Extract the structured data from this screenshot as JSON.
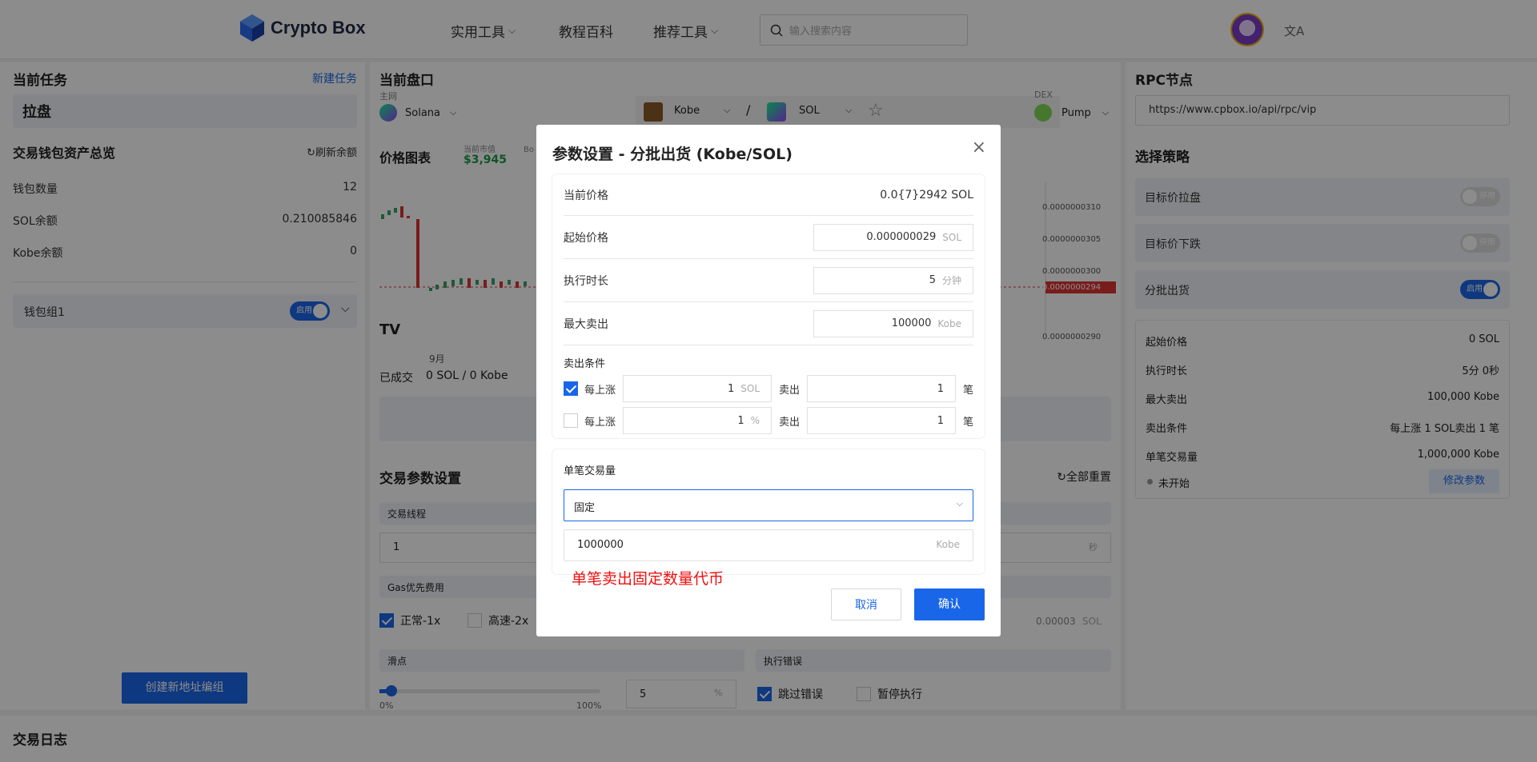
{
  "header": {
    "logo_text": "Crypto Box",
    "nav": [
      {
        "label": "实用工具",
        "dropdown": true
      },
      {
        "label": "教程百科",
        "dropdown": false
      },
      {
        "label": "推荐工具",
        "dropdown": true
      }
    ],
    "search_placeholder": "输入搜索内容",
    "translate_icon": "文A"
  },
  "left_panel": {
    "title": "当前任务",
    "new_task_link": "新建任务",
    "task_name": "拉盘",
    "assets_title": "交易钱包资产总览",
    "refresh_label": "刷新余额",
    "rows": [
      {
        "label": "钱包数量",
        "value": "12"
      },
      {
        "label": "SOL余额",
        "value": "0.210085846"
      },
      {
        "label": "Kobe余额",
        "value": "0"
      }
    ],
    "wallet_group": "钱包组1",
    "wallet_toggle": "启用",
    "create_button": "创建新地址编组"
  },
  "mid_panel": {
    "title": "当前盘口",
    "network_label": "主网",
    "network": "Solana",
    "token_a": "Kobe",
    "separator": "/",
    "token_b": "SOL",
    "dex_label": "DEX",
    "dex": "Pump",
    "chart_title": "价格图表",
    "market_cap_label": "当前市值",
    "market_cap": "$3,945",
    "bo_label": "Bo",
    "price_ticks": [
      "0.0000000310",
      "0.0000000305",
      "0.0000000300",
      "0.0000000294",
      "0.0000000290"
    ],
    "month_label": "9月",
    "tv_logo": "TV",
    "traded_label": "已成交",
    "traded_value": "0 SOL / 0 Kobe",
    "params_title": "交易参数设置",
    "reset_all": "全部重置",
    "threads_label": "交易线程",
    "threads_value": "1",
    "seconds_unit": "秒",
    "gas_label": "Gas优先费用",
    "gas_normal": "正常-1x",
    "gas_fast": "高速-2x",
    "gas_value": "0.00003",
    "gas_unit": "SOL",
    "slippage_label": "滑点",
    "slippage_min": "0%",
    "slippage_max": "100%",
    "slippage_value": "5",
    "slippage_unit": "%",
    "error_label": "执行错误",
    "skip_error": "跳过错误",
    "pause_exec": "暂停执行"
  },
  "right_panel": {
    "rpc_title": "RPC节点",
    "rpc_url": "https://www.cpbox.io/api/rpc/vip",
    "strategy_title": "选择策略",
    "strategies": [
      {
        "label": "目标价拉盘",
        "toggle": "停用",
        "on": false
      },
      {
        "label": "目标价下跌",
        "toggle": "停用",
        "on": false
      },
      {
        "label": "分批出货",
        "toggle": "启用",
        "on": true
      }
    ],
    "summary": [
      {
        "label": "起始价格",
        "value": "0 SOL"
      },
      {
        "label": "执行时长",
        "value": "5分 0秒"
      },
      {
        "label": "最大卖出",
        "value": "100,000 Kobe"
      },
      {
        "label": "卖出条件",
        "value": "每上涨 1 SOL卖出 1 笔"
      },
      {
        "label": "单笔交易量",
        "value": "1,000,000 Kobe"
      }
    ],
    "status": "未开始",
    "edit_button": "修改参数"
  },
  "bottom_panel": {
    "title": "交易日志"
  },
  "modal": {
    "title": "参数设置 - 分批出货 (Kobe/SOL)",
    "close": "×",
    "current_price_label": "当前价格",
    "current_price": "0.0{7}2942 SOL",
    "start_price_label": "起始价格",
    "start_price": "0.000000029",
    "start_price_unit": "SOL",
    "duration_label": "执行时长",
    "duration": "5",
    "duration_unit": "分钟",
    "max_sell_label": "最大卖出",
    "max_sell": "100000",
    "max_sell_unit": "Kobe",
    "sell_condition_label": "卖出条件",
    "cond1": {
      "checked": true,
      "prefix": "每上涨",
      "value": "1",
      "unit": "SOL",
      "sell": "卖出",
      "count": "1",
      "suffix": "笔"
    },
    "cond2": {
      "checked": false,
      "prefix": "每上涨",
      "value": "1",
      "unit": "%",
      "sell": "卖出",
      "count": "1",
      "suffix": "笔"
    },
    "trade_amount_label": "单笔交易量",
    "mode_select": "固定",
    "amount_value": "1000000",
    "amount_unit": "Kobe",
    "hint": "单笔卖出固定数量代币",
    "cancel": "取消",
    "confirm": "确认"
  }
}
